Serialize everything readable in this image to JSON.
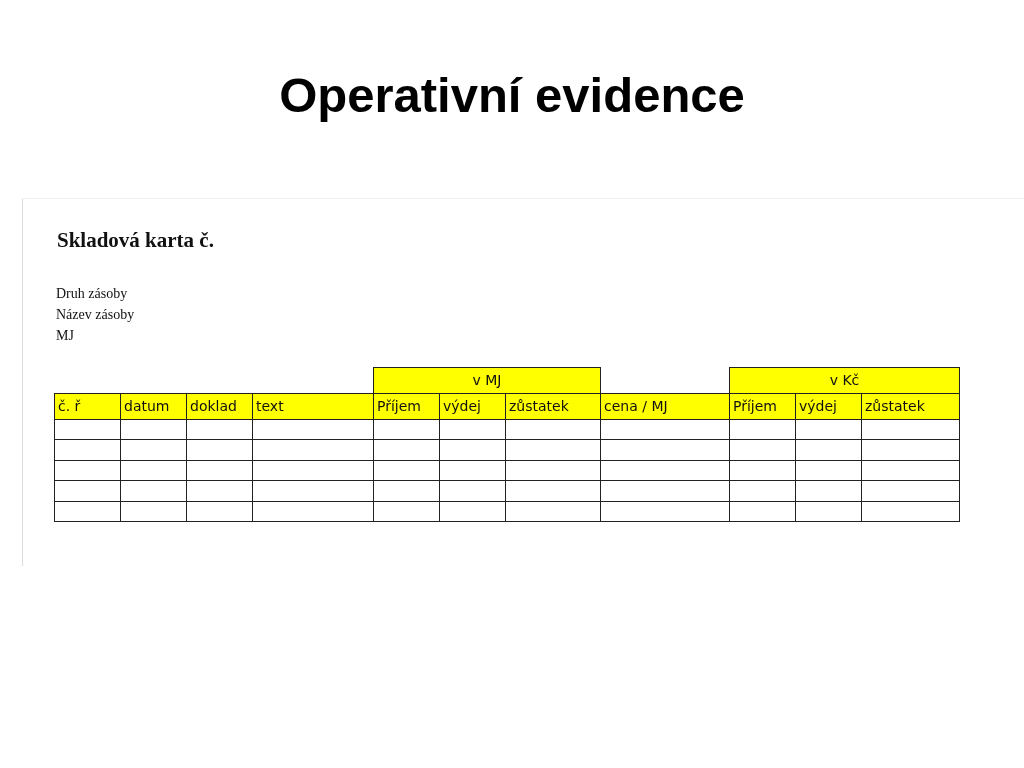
{
  "slide_title": "Operativní evidence",
  "document": {
    "heading": "Skladová karta č.",
    "fields": [
      "Druh zásoby",
      "Název zásoby",
      "MJ"
    ],
    "table": {
      "column_groups": [
        {
          "columns": [
            "č. ř",
            "datum",
            "doklad",
            "text"
          ]
        },
        {
          "label": "v MJ",
          "columns": [
            "Příjem",
            "výdej",
            "zůstatek"
          ]
        },
        {
          "columns": [
            "cena / MJ"
          ]
        },
        {
          "label": "v Kč",
          "columns": [
            "Příjem",
            "výdej",
            "zůstatek"
          ]
        }
      ]
    }
  }
}
